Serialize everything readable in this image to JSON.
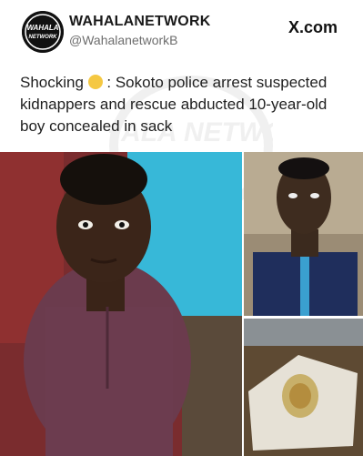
{
  "account": {
    "avatar_text_line1": "WAHALA",
    "avatar_text_line2": "NETWORK",
    "name": "WAHALANETWORK",
    "handle": "@WahalanetworkB",
    "platform": "X.com"
  },
  "tweet": {
    "text_before_emoji": "Shocking",
    "emoji_icon": "flushed-face-emoji",
    "text_after_emoji": " : Sokoto police arrest suspected kidnappers and rescue abducted 10-year-old boy concealed in sack"
  },
  "watermark_text": "WAHALA NETWORK",
  "colors": {
    "accent_blue": "#37b8d8",
    "background": "#ffffff"
  }
}
